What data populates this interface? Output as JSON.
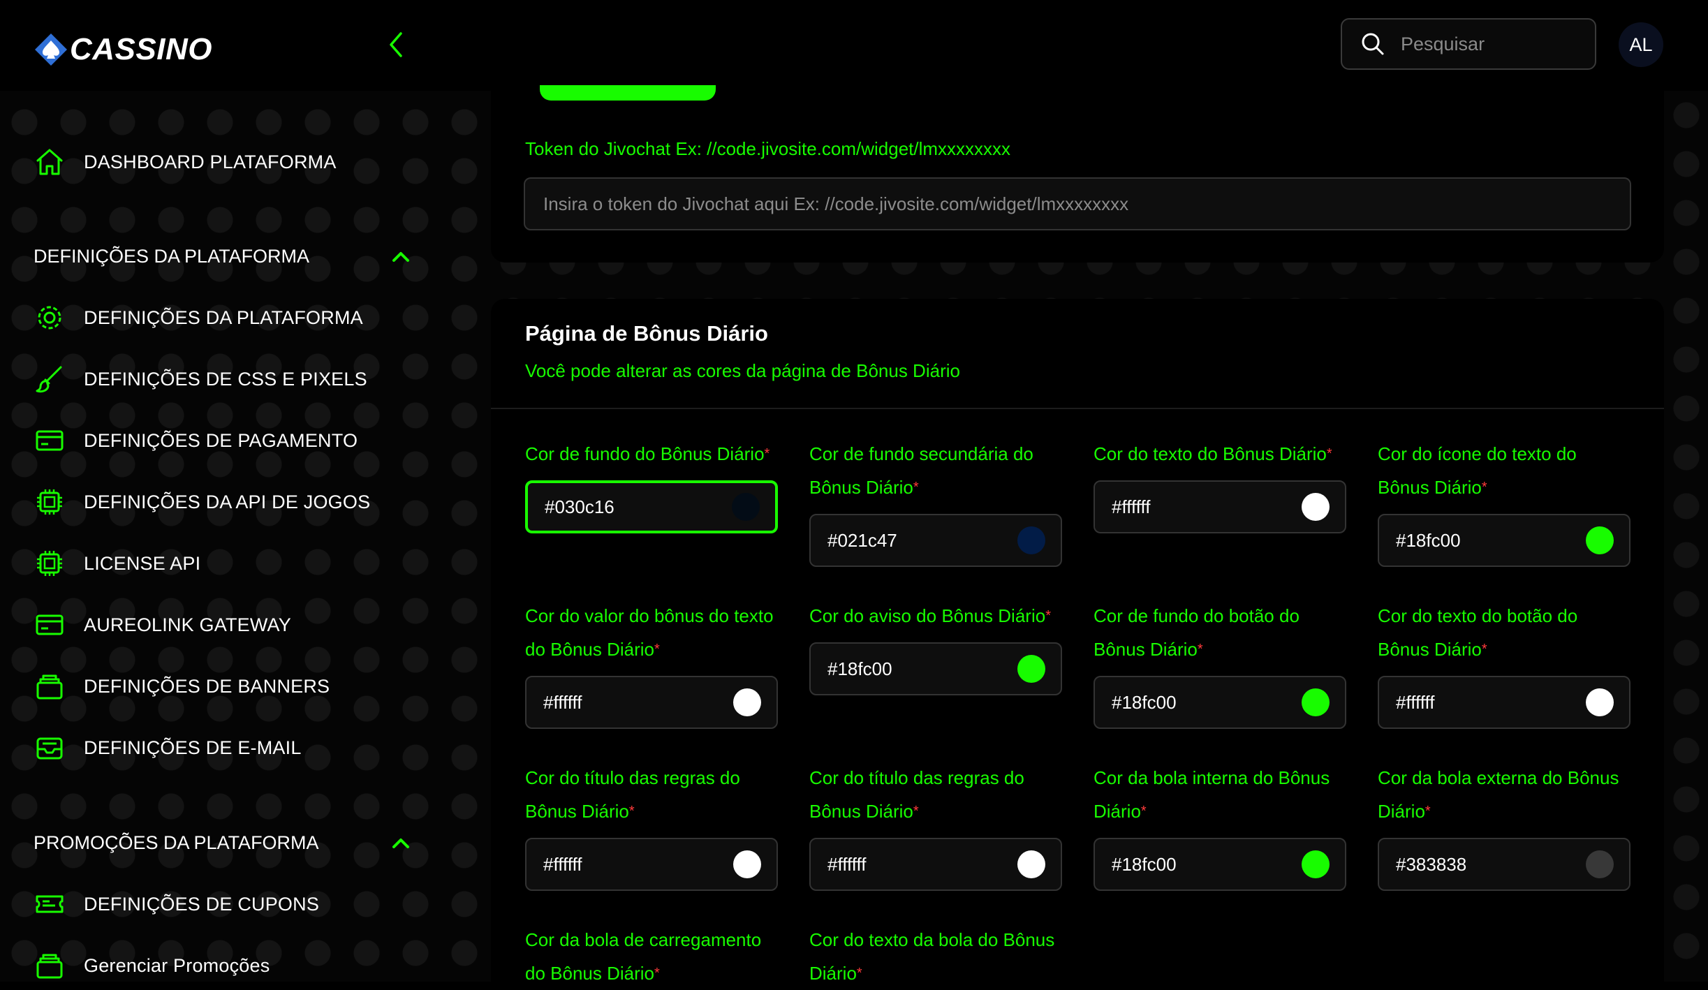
{
  "brand": {
    "name": "CASSINO"
  },
  "header": {
    "search_placeholder": "Pesquisar",
    "avatar_initials": "AL"
  },
  "sidebar": {
    "items": [
      {
        "label": "DASHBOARD PLATAFORMA",
        "icon": "home-icon"
      },
      {
        "label": "DEFINIÇÕES DA PLATAFORMA",
        "icon": "gear-icon"
      },
      {
        "label": "DEFINIÇÕES DE CSS E PIXELS",
        "icon": "brush-icon"
      },
      {
        "label": "DEFINIÇÕES DE PAGAMENTO",
        "icon": "credit-card-icon"
      },
      {
        "label": "DEFINIÇÕES DA API DE JOGOS",
        "icon": "chip-icon"
      },
      {
        "label": "LICENSE API",
        "icon": "chip-icon"
      },
      {
        "label": "AUREOLINK GATEWAY",
        "icon": "credit-card-icon"
      },
      {
        "label": "DEFINIÇÕES DE BANNERS",
        "icon": "stack-icon"
      },
      {
        "label": "DEFINIÇÕES DE E-MAIL",
        "icon": "inbox-icon"
      },
      {
        "label": "DEFINIÇÕES DE CUPONS",
        "icon": "ticket-icon"
      },
      {
        "label": "Gerenciar Promoções",
        "icon": "stack-icon"
      }
    ],
    "sections": [
      {
        "label": "DEFINIÇÕES DA PLATAFORMA"
      },
      {
        "label": "PROMOÇÕES DA PLATAFORMA"
      }
    ]
  },
  "jivochat": {
    "label": "Token do Jivochat Ex: //code.jivosite.com/widget/lmxxxxxxxx",
    "placeholder": "Insira o token do Jivochat aqui Ex: //code.jivosite.com/widget/lmxxxxxxxx"
  },
  "bonus_page": {
    "title": "Página de Bônus Diário",
    "subtitle": "Você pode alterar as cores da página de Bônus Diário",
    "required_mark": "*",
    "fields": [
      {
        "label": "Cor de fundo do Bônus Diário",
        "value": "#030c16",
        "color": "#030c16"
      },
      {
        "label": "Cor de fundo secundária do Bônus Diário",
        "value": "#021c47",
        "color": "#021c47"
      },
      {
        "label": "Cor do texto do Bônus Diário",
        "value": "#ffffff",
        "color": "#ffffff"
      },
      {
        "label": "Cor do ícone do texto do Bônus Diário",
        "value": "#18fc00",
        "color": "#18fc00"
      },
      {
        "label": "Cor do valor do bônus do texto do Bônus Diário",
        "value": "#ffffff",
        "color": "#ffffff"
      },
      {
        "label": "Cor do aviso do Bônus Diário",
        "value": "#18fc00",
        "color": "#18fc00"
      },
      {
        "label": "Cor de fundo do botão do Bônus Diário",
        "value": "#18fc00",
        "color": "#18fc00"
      },
      {
        "label": "Cor do texto do botão do Bônus Diário",
        "value": "#ffffff",
        "color": "#ffffff"
      },
      {
        "label": "Cor do título das regras do Bônus Diário",
        "value": "#ffffff",
        "color": "#ffffff"
      },
      {
        "label": "Cor do título das regras do Bônus Diário",
        "value": "#ffffff",
        "color": "#ffffff"
      },
      {
        "label": "Cor da bola interna do Bônus Diário",
        "value": "#18fc00",
        "color": "#18fc00"
      },
      {
        "label": "Cor da bola externa do Bônus Diário",
        "value": "#383838",
        "color": "#383838"
      },
      {
        "label": "Cor da bola de carregamento do Bônus Diário",
        "value": "",
        "color": ""
      },
      {
        "label": "Cor do texto da bola do Bônus Diário",
        "value": "",
        "color": ""
      }
    ]
  },
  "colors": {
    "accent": "#18fc00",
    "background": "#000000",
    "logo_blue": "#2f6fd6"
  }
}
